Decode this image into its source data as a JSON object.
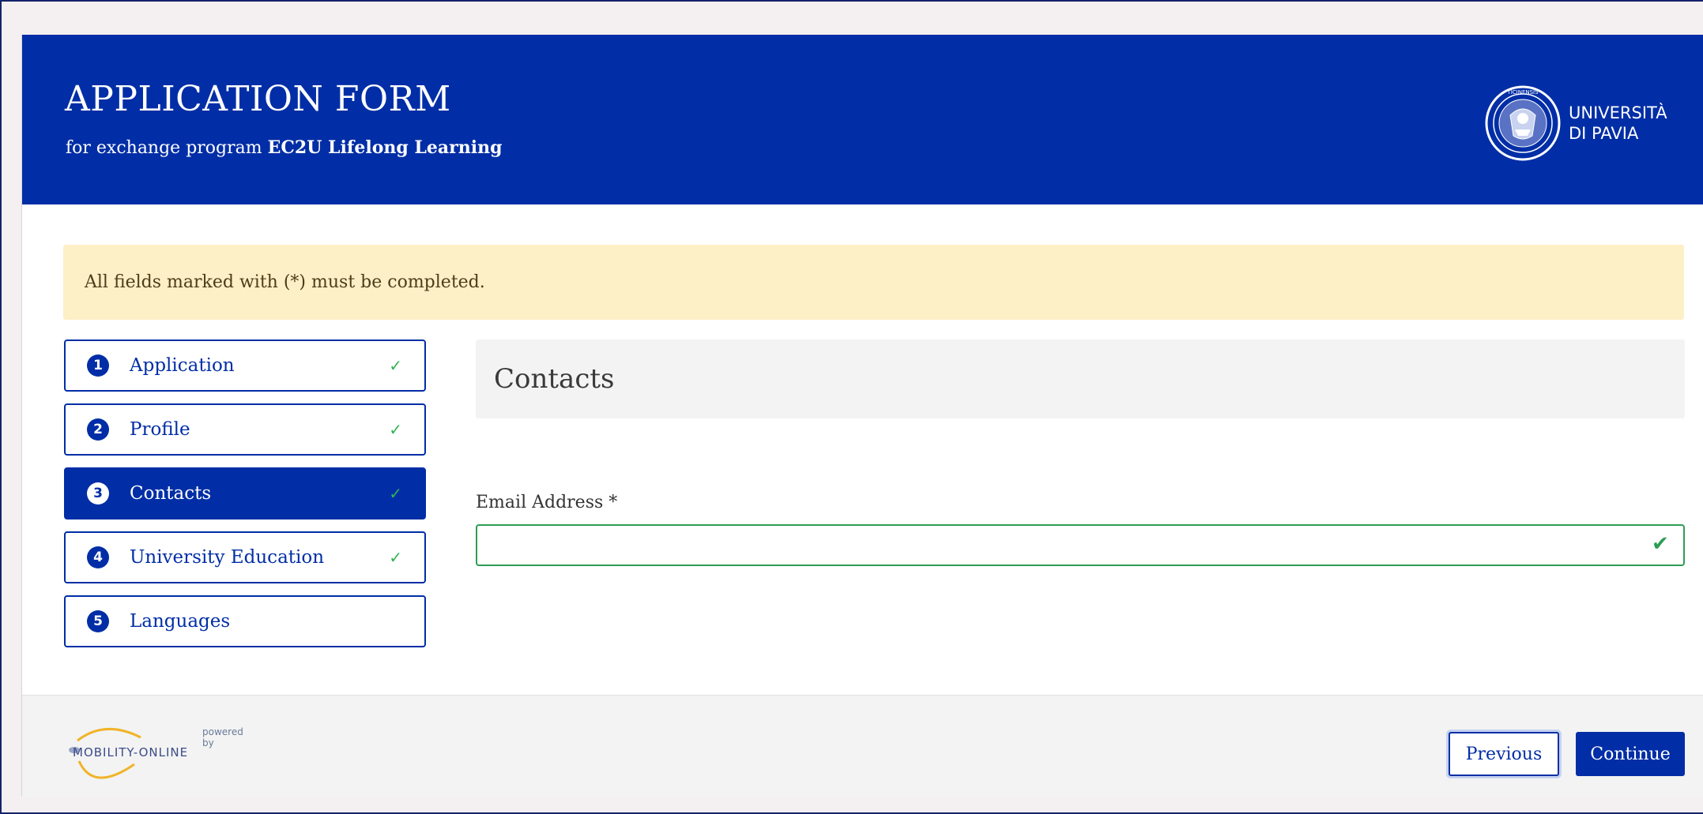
{
  "header": {
    "title": "APPLICATION FORM",
    "subtitle_prefix": "for exchange program ",
    "subtitle_program": "EC2U Lifelong Learning",
    "university_line1": "UNIVERSITÀ",
    "university_line2": "DI PAVIA",
    "logo_icon": "university-seal-icon"
  },
  "notice": {
    "text": "All fields marked with (*) must be completed."
  },
  "steps": [
    {
      "number": "1",
      "label": "Application",
      "check": "✓",
      "completed": true,
      "active": false
    },
    {
      "number": "2",
      "label": "Profile",
      "check": "✓",
      "completed": true,
      "active": false
    },
    {
      "number": "3",
      "label": "Contacts",
      "check": "✓",
      "completed": true,
      "active": true
    },
    {
      "number": "4",
      "label": "University Education",
      "check": "✓",
      "completed": true,
      "active": false
    },
    {
      "number": "5",
      "label": "Languages",
      "check": "",
      "completed": false,
      "active": false
    }
  ],
  "section": {
    "title": "Contacts"
  },
  "form": {
    "email_label": "Email Address *",
    "email_value": "",
    "email_valid_mark": "✔"
  },
  "footer": {
    "powered_by": "powered by",
    "brand": "MOBILITY-ONLINE",
    "previous_label": "Previous",
    "continue_label": "Continue"
  },
  "colors": {
    "primary": "#012ea6",
    "notice_bg": "#fdefc6",
    "success": "#2e9d53",
    "page_bg": "#f4eff0"
  }
}
